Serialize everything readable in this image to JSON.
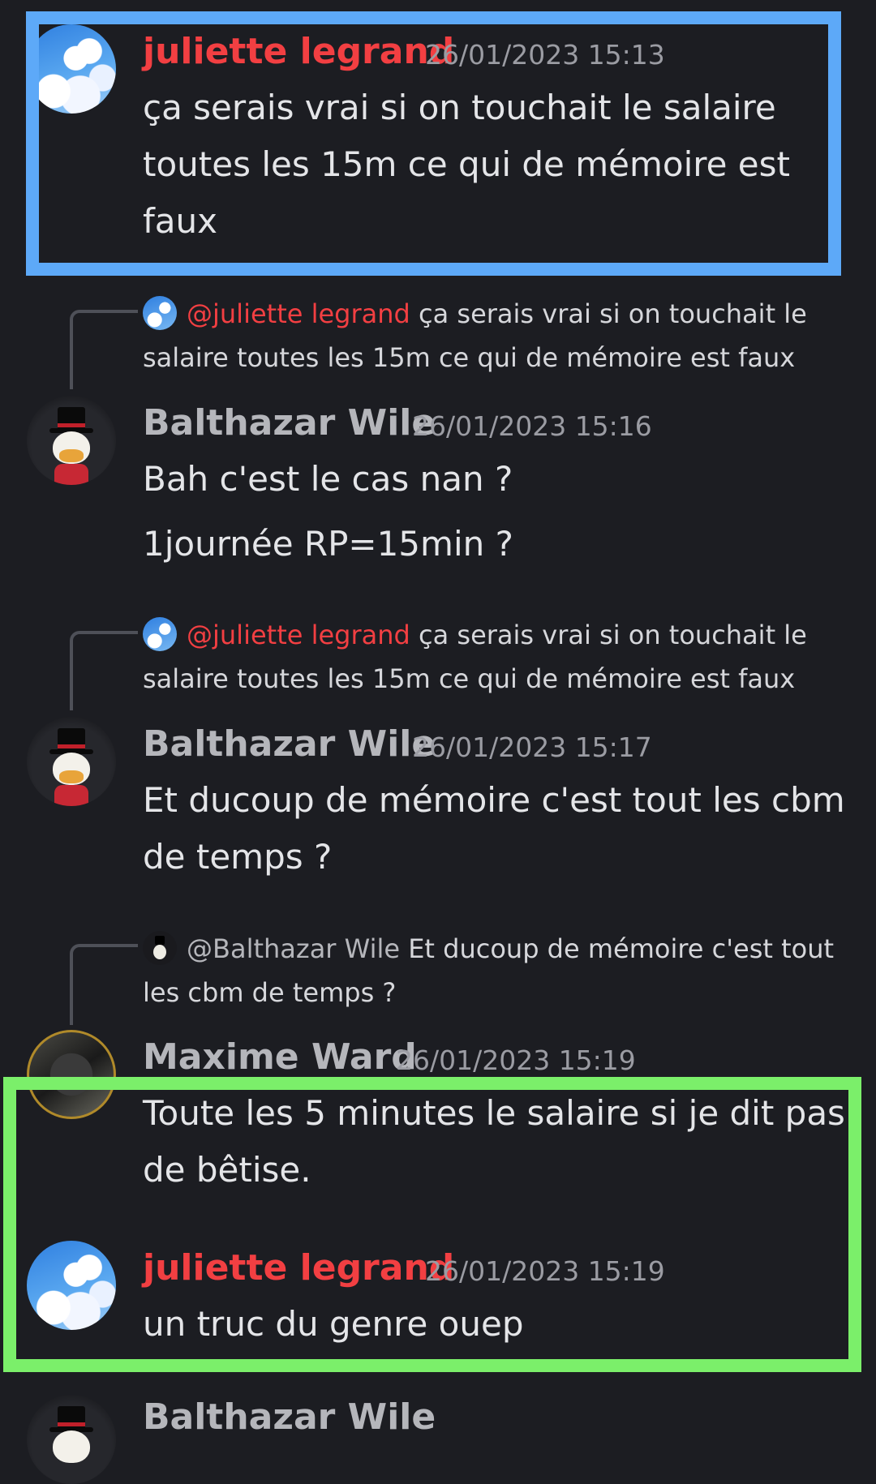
{
  "messages": [
    {
      "author": "juliette legrand",
      "timestamp": "26/01/2023 15:13",
      "lines": [
        "ça serais vrai si on touchait le salaire",
        "toutes les 15m ce qui de mémoire est",
        "faux"
      ]
    },
    {
      "reply": {
        "mention": "@juliette legrand",
        "line1": " ça serais vrai si on touchait le",
        "line2": "salaire toutes les 15m ce qui de mémoire est faux"
      },
      "author": "Balthazar Wile",
      "timestamp": "26/01/2023 15:16",
      "lines": [
        "Bah c'est le cas nan ?",
        "1journée RP=15min ?"
      ]
    },
    {
      "reply": {
        "mention": "@juliette legrand",
        "line1": " ça serais vrai si on touchait le",
        "line2": "salaire toutes les 15m ce qui de mémoire est faux"
      },
      "author": "Balthazar Wile",
      "timestamp": "26/01/2023 15:17",
      "lines": [
        "Et ducoup de mémoire c'est tout les cbm",
        "de temps ?"
      ]
    },
    {
      "reply": {
        "mention": "@Balthazar Wile",
        "line1": " Et ducoup de mémoire c'est tout",
        "line2": "les cbm de temps ?"
      },
      "author": "Maxime Ward",
      "timestamp": "26/01/2023 15:19",
      "lines": [
        "Toute les 5 minutes le salaire si je dit pas",
        "de bêtise."
      ]
    },
    {
      "author": "juliette legrand",
      "timestamp": "26/01/2023 15:19",
      "lines": [
        "un truc du genre ouep"
      ]
    },
    {
      "author": "Balthazar Wile"
    }
  ],
  "colors": {
    "background": "#1c1d22",
    "mention_red": "#f23f42",
    "highlight_blue": "#5da9f8",
    "highlight_green": "#7bef6a"
  }
}
